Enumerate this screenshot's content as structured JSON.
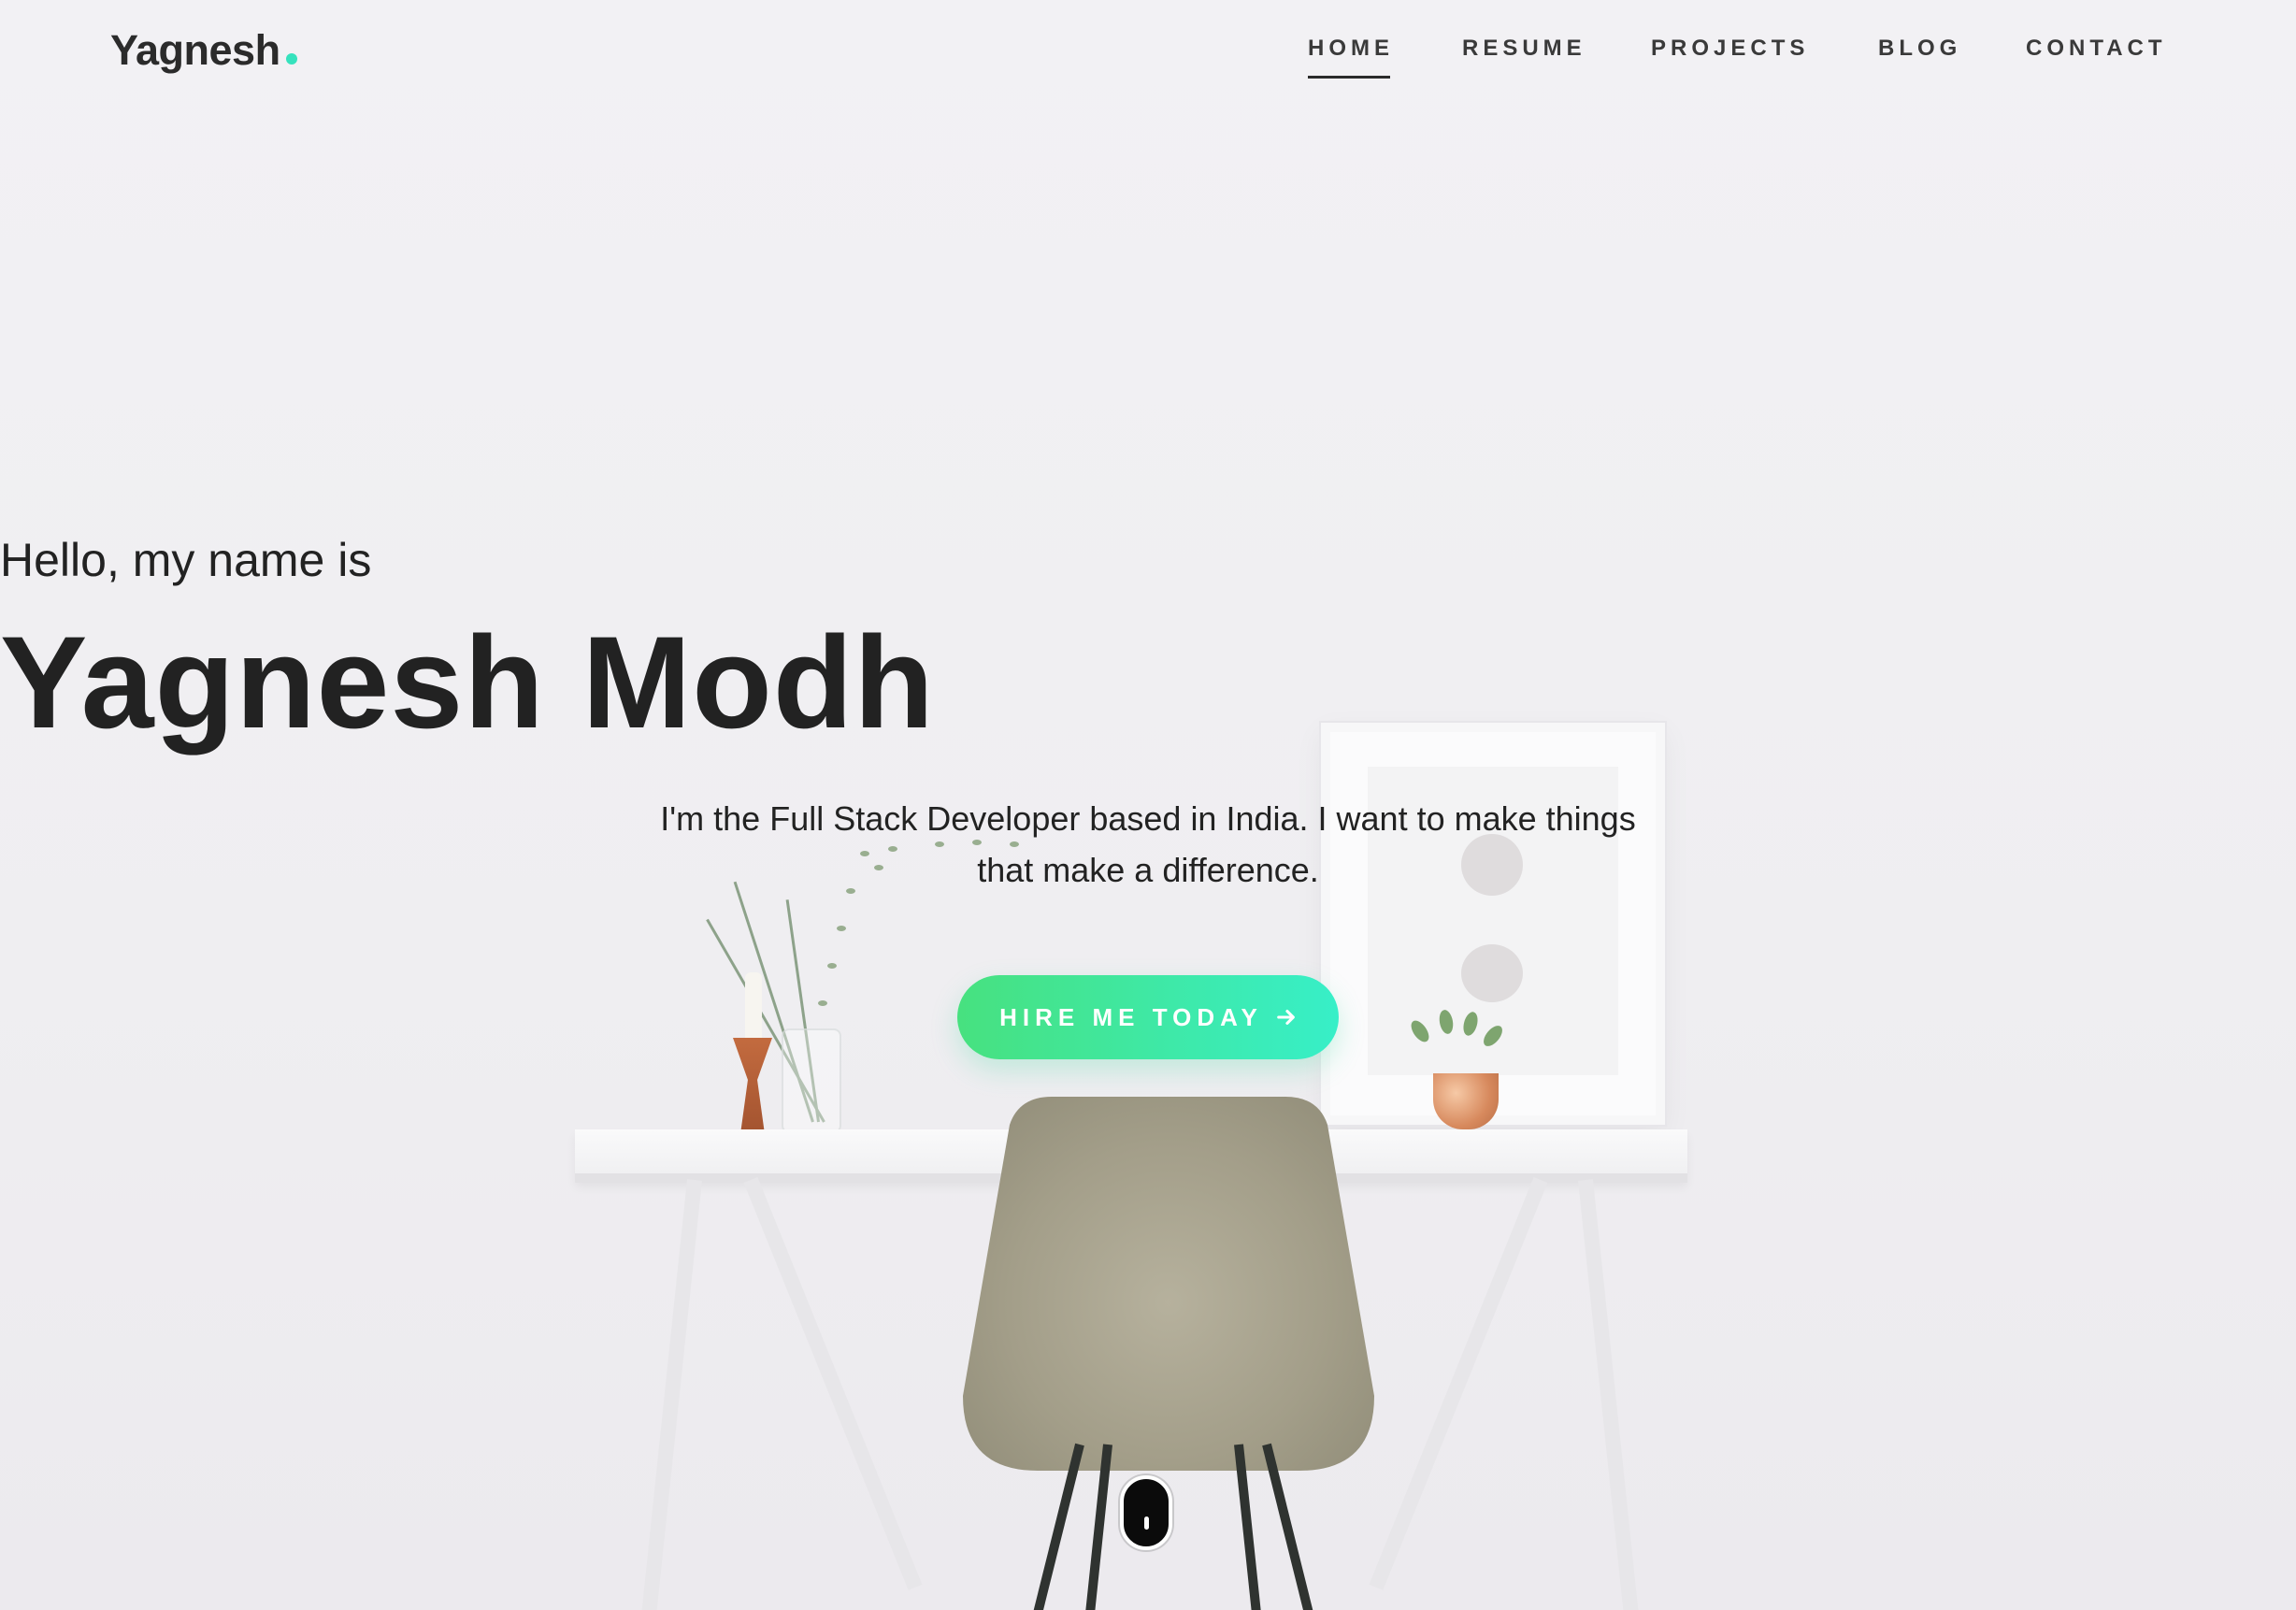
{
  "header": {
    "logo_text": "Yagnesh",
    "logo_dot_color": "#36e2bd",
    "nav": {
      "home": "HOME",
      "resume": "RESUME",
      "projects": "PROJECTS",
      "blog": "BLOG",
      "contact": "CONTACT"
    },
    "active_nav": "HOME"
  },
  "hero": {
    "greeting": "Hello, my name is",
    "name": "Yagnesh Modh",
    "tagline": "I'm the Full Stack Developer based in India. I want to make things that make a difference.",
    "cta_label": "HIRE ME TODAY",
    "cta_icon": "arrow-right-icon",
    "cta_gradient": [
      "#47e17f",
      "#37efc8"
    ]
  },
  "scroll_indicator": {
    "icon": "mouse-scroll-icon"
  }
}
